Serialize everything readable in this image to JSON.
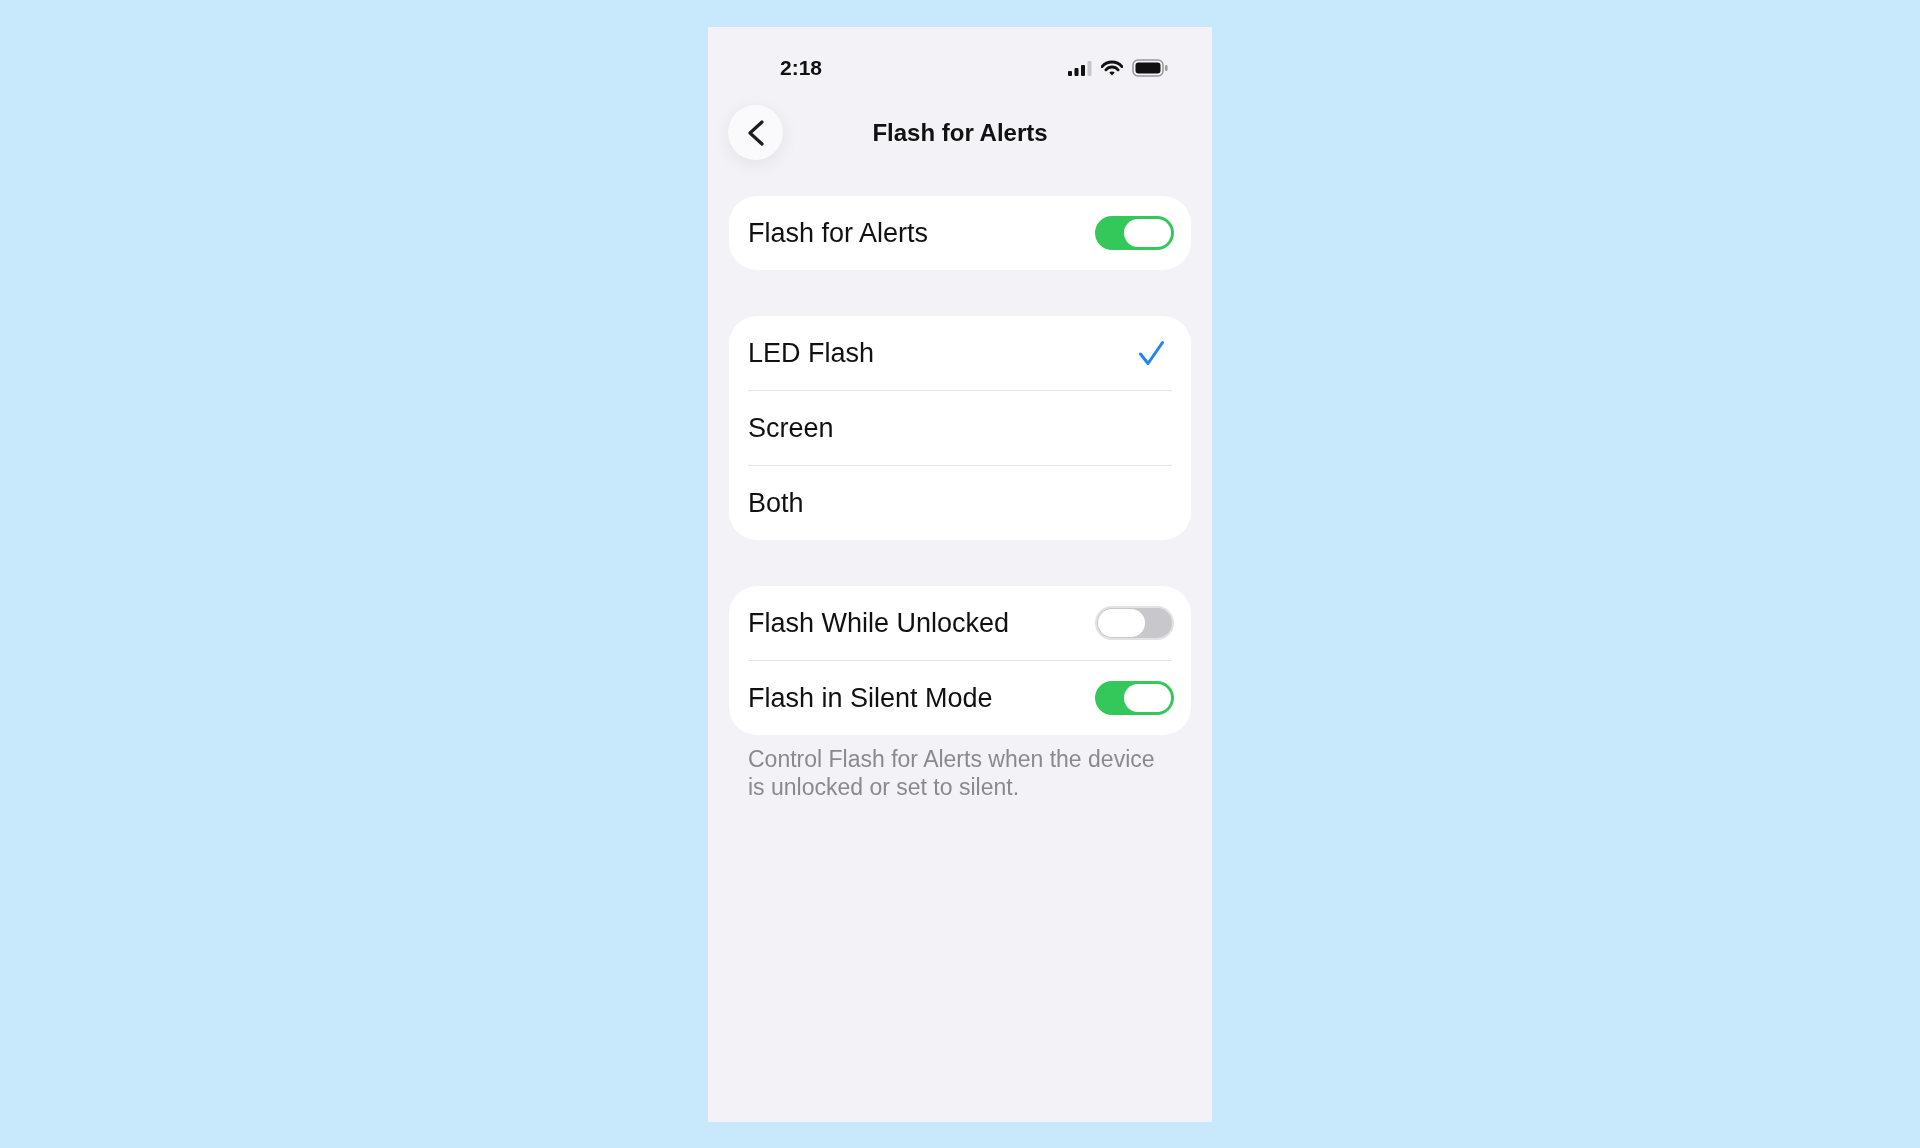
{
  "status_bar": {
    "time": "2:18"
  },
  "nav": {
    "title": "Flash for Alerts"
  },
  "sections": [
    {
      "rows": [
        {
          "kind": "toggle",
          "label": "Flash for Alerts",
          "on": true
        }
      ]
    },
    {
      "rows": [
        {
          "kind": "option",
          "label": "LED Flash",
          "selected": true
        },
        {
          "kind": "option",
          "label": "Screen",
          "selected": false
        },
        {
          "kind": "option",
          "label": "Both",
          "selected": false
        }
      ]
    },
    {
      "rows": [
        {
          "kind": "toggle",
          "label": "Flash While Unlocked",
          "on": false
        },
        {
          "kind": "toggle",
          "label": "Flash in Silent Mode",
          "on": true
        }
      ],
      "footer": "Control Flash for Alerts when the device is unlocked or set to silent."
    }
  ]
}
